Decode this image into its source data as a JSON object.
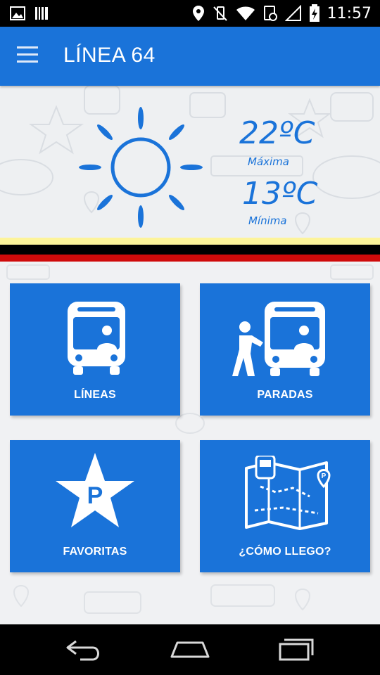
{
  "status_bar": {
    "time": "11:57",
    "left_icons": [
      "image-icon",
      "barcode-icon"
    ],
    "right_icons": [
      "location-icon",
      "vibrate-off-icon",
      "wifi-icon",
      "data-saver-icon",
      "signal-icon",
      "battery-icon"
    ]
  },
  "app_bar": {
    "title": "LÍNEA 64",
    "menu_icon": "hamburger-menu-icon"
  },
  "weather": {
    "icon": "sun-icon",
    "max_temp": "22ºC",
    "max_label": "Máxima",
    "min_temp": "13ºC",
    "min_label": "Mínima"
  },
  "tiles": [
    {
      "label": "LÍNEAS",
      "icon": "bus-icon"
    },
    {
      "label": "PARADAS",
      "icon": "bus-stop-icon"
    },
    {
      "label": "FAVORITAS",
      "icon": "star-parking-icon"
    },
    {
      "label": "¿CÓMO LLEGO?",
      "icon": "route-map-icon"
    }
  ],
  "nav_bar": {
    "icons": [
      "back-icon",
      "home-icon",
      "recents-icon"
    ]
  },
  "colors": {
    "accent": "#1a73d9",
    "status_bar": "#000000",
    "stripe_yellow": "#fdf49a",
    "stripe_black": "#000000",
    "stripe_red": "#cf0a0a"
  }
}
